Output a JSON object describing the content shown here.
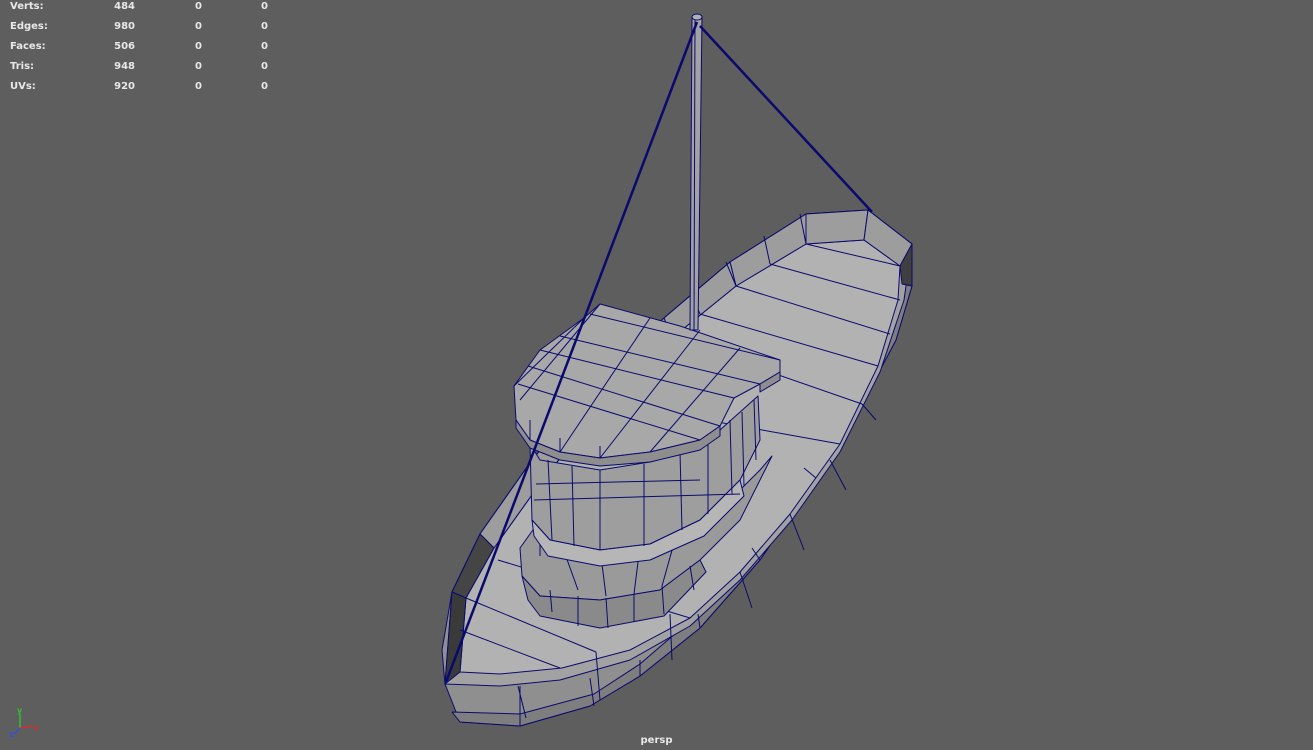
{
  "hud": {
    "rows": [
      {
        "label": "Verts:",
        "total": "484",
        "selected": "0",
        "component": "0"
      },
      {
        "label": "Edges:",
        "total": "980",
        "selected": "0",
        "component": "0"
      },
      {
        "label": "Faces:",
        "total": "506",
        "selected": "0",
        "component": "0"
      },
      {
        "label": "Tris:",
        "total": "948",
        "selected": "0",
        "component": "0"
      },
      {
        "label": "UVs:",
        "total": "920",
        "selected": "0",
        "component": "0"
      }
    ]
  },
  "camera": {
    "name": "persp"
  },
  "axes": {
    "y": "y",
    "z": "z",
    "x": "x"
  },
  "colors": {
    "background": "#5e5e5e",
    "mesh_face": "#a9a9a9",
    "mesh_wire": "#0a0a6e",
    "hud_text": "#e8e8e8",
    "axis_x": "#d03030",
    "axis_y": "#30c030",
    "axis_z": "#3050e0"
  },
  "icons": [
    "axis-gizmo-icon"
  ]
}
